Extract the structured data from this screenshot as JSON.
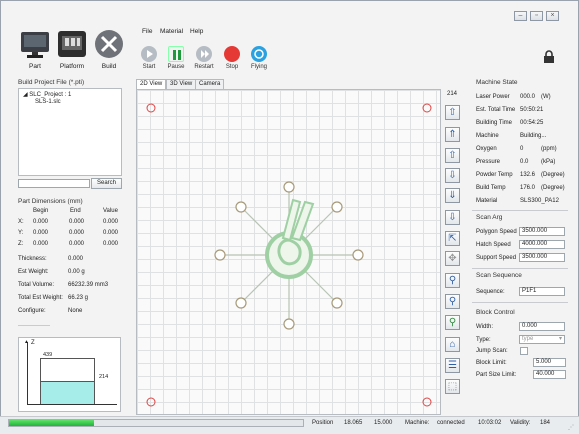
{
  "window": {
    "minimize": "–",
    "maximize": "▫",
    "close": "×"
  },
  "big_toolbar": [
    {
      "label": "Part",
      "icon": "monitor-icon"
    },
    {
      "label": "Platform",
      "icon": "printer-icon"
    },
    {
      "label": "Build",
      "icon": "tools-icon"
    }
  ],
  "menu": [
    "File",
    "Material",
    "Help"
  ],
  "toolbar": [
    {
      "label": "Start",
      "color": "#9aa3ab"
    },
    {
      "label": "Pause",
      "color": "#28a745"
    },
    {
      "label": "Restart",
      "color": "#9aa3ab"
    },
    {
      "label": "Stop",
      "color": "#e53935"
    },
    {
      "label": "Flying",
      "color": "#2aa1e0"
    }
  ],
  "left": {
    "project_title": "Build Project File (*.pti)",
    "tree_root": "SLC_Project : 1",
    "tree_child": "SLS-1.slc",
    "search_button": "Search",
    "dimensions_title": "Part Dimensions (mm)",
    "dim_headers": [
      "Begin",
      "End",
      "Value"
    ],
    "dims": [
      {
        "axis": "X:",
        "begin": "0.000",
        "end": "0.000",
        "value": "0.000"
      },
      {
        "axis": "Y:",
        "begin": "0.000",
        "end": "0.000",
        "value": "0.000"
      },
      {
        "axis": "Z:",
        "begin": "0.000",
        "end": "0.000",
        "value": "0.000"
      }
    ],
    "props": [
      {
        "k": "Thickness:",
        "v": "0.000"
      },
      {
        "k": "Est Weight:",
        "v": "0.00 g"
      },
      {
        "k": "Total Volume:",
        "v": "66232.39 mm3"
      },
      {
        "k": "Total Est Weight:",
        "v": "66.23 g"
      },
      {
        "k": "Configure:",
        "v": "None"
      }
    ],
    "progress_axis": "Z",
    "progress_top": "439",
    "progress_current": "214",
    "progress_fraction": 0.49
  },
  "center": {
    "tabs": [
      "2D View",
      "3D View",
      "Camera"
    ],
    "layer": "214"
  },
  "machine_state": {
    "title": "Machine State",
    "rows": [
      {
        "k": "Laser Power",
        "v": "000.0",
        "u": "(W)"
      },
      {
        "k": "Est. Total Time",
        "v": "50:50:21",
        "u": ""
      },
      {
        "k": "Building Time",
        "v": "00:54:25",
        "u": ""
      },
      {
        "k": "Machine",
        "v": "Building...",
        "u": ""
      },
      {
        "k": "Oxygen",
        "v": "0",
        "u": "(ppm)"
      },
      {
        "k": "Pressure",
        "v": "0.0",
        "u": "(kPa)"
      },
      {
        "k": "Powder Temp",
        "v": "132.6",
        "u": "(Degree)"
      },
      {
        "k": "Build Temp",
        "v": "176.0",
        "u": "(Degree)"
      },
      {
        "k": "Material",
        "v": "SLS300_PA12",
        "u": ""
      }
    ]
  },
  "scan_arg": {
    "title": "Scan Arg",
    "rows": [
      {
        "k": "Polygon Speed",
        "v": "3500.000"
      },
      {
        "k": "Hatch Speed",
        "v": "4000.000"
      },
      {
        "k": "Support Speed",
        "v": "3500.000"
      }
    ]
  },
  "scan_seq": {
    "title": "Scan Sequence",
    "k": "Sequence:",
    "v": "P1F1"
  },
  "block": {
    "title": "Block Control",
    "rows": [
      {
        "k": "Width:",
        "v": "0.000"
      },
      {
        "k": "Type:",
        "v": "type"
      },
      {
        "k": "Jump Scan:",
        "v": ""
      },
      {
        "k": "Block Limit:",
        "v": "5.000"
      },
      {
        "k": "Part Size Limit:",
        "v": "40.000"
      }
    ]
  },
  "status": {
    "position_label": "Position",
    "x": "18.065",
    "y": "15.000",
    "machine_label": "Machine:",
    "machine_state": "connected",
    "time": "10:03:02",
    "validity_label": "Validity:",
    "validity": "184",
    "progress_fraction": 0.29
  }
}
